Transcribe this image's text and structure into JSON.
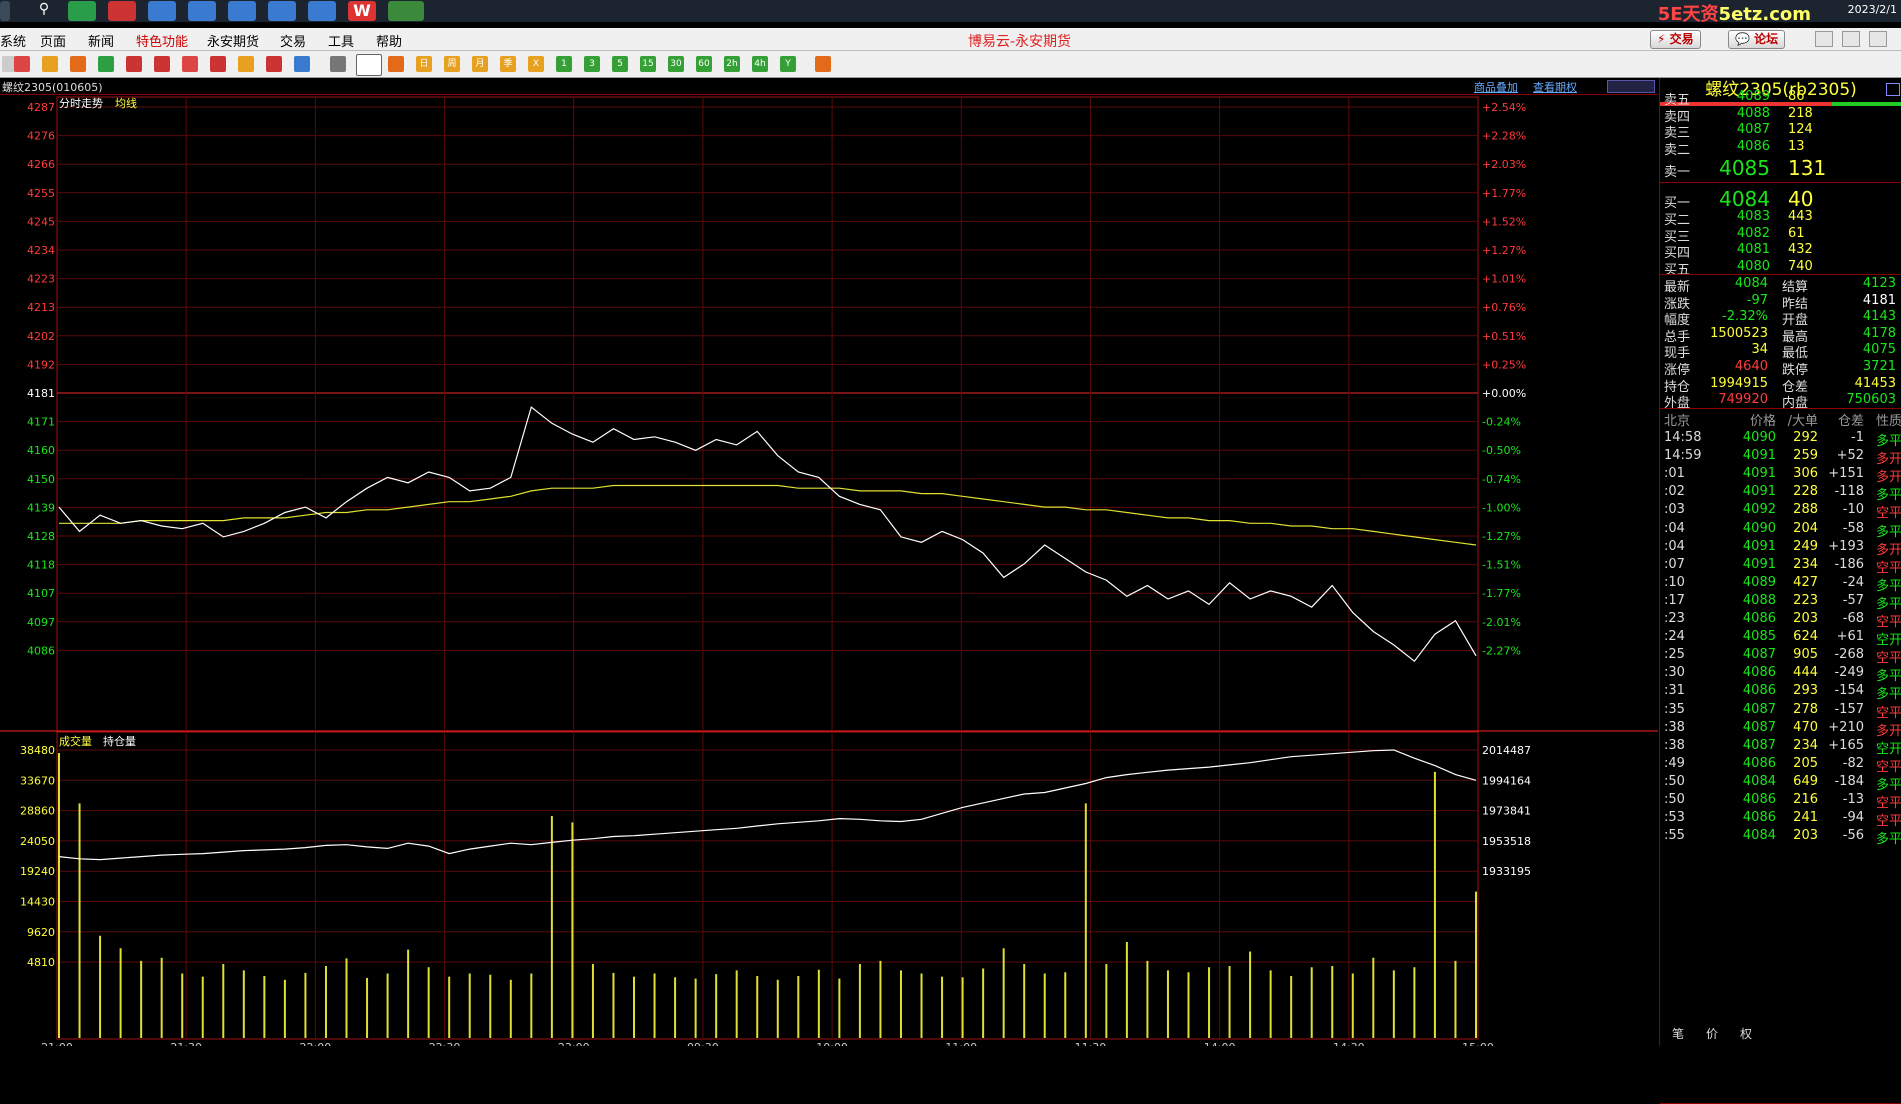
{
  "taskbar": {
    "watermark_a": "5E天资",
    "watermark_b": "5etz.com",
    "date": "2023/2/1"
  },
  "menubar": {
    "items": [
      "系统",
      "页面",
      "新闻",
      "特色功能",
      "永安期货",
      "交易",
      "工具",
      "帮助"
    ],
    "title": "博易云-永安期货",
    "trade_button": "交易",
    "forum_button": "论坛"
  },
  "toolbar": {
    "period_buttons": [
      "日",
      "周",
      "月",
      "季",
      "X",
      "1",
      "3",
      "5",
      "15",
      "30",
      "60",
      "2h",
      "4h",
      "Y"
    ]
  },
  "chart": {
    "header": "螺纹2305(010605)",
    "link_overlay": "商品叠加",
    "link_options": "查看期权",
    "price_legend_a": "分时走势",
    "price_legend_b": "均线",
    "vol_legend_a": "成交量",
    "vol_legend_b": "持仓量"
  },
  "chart_data": {
    "type": "line",
    "price_ticks": [
      4287,
      4276,
      4266,
      4255,
      4245,
      4234,
      4223,
      4213,
      4202,
      4192,
      4181,
      4171,
      4160,
      4150,
      4139,
      4128,
      4118,
      4107,
      4097,
      4086
    ],
    "pct_ticks": [
      "+2.54%",
      "+2.28%",
      "+2.03%",
      "+1.77%",
      "+1.52%",
      "+1.27%",
      "+1.01%",
      "+0.76%",
      "+0.51%",
      "+0.25%",
      "+0.00%",
      "-0.24%",
      "-0.50%",
      "-0.74%",
      "-1.00%",
      "-1.27%",
      "-1.51%",
      "-1.77%",
      "-2.01%",
      "-2.27%"
    ],
    "volume_ticks": [
      38480,
      33670,
      28860,
      24050,
      19240,
      14430,
      9620,
      4810
    ],
    "oi_ticks": [
      2014487,
      1994164,
      1973841,
      1953518,
      1933195
    ],
    "time_ticks": [
      "21:00",
      "21:30",
      "22:00",
      "22:30",
      "23:00",
      "09:30",
      "10:00",
      "11:00",
      "11:30",
      "14:00",
      "14:30",
      "15:00"
    ],
    "prev_settle": 4181,
    "price_series": [
      4139,
      4130,
      4136,
      4133,
      4134,
      4132,
      4131,
      4133,
      4128,
      4130,
      4133,
      4137,
      4139,
      4135,
      4141,
      4146,
      4150,
      4148,
      4152,
      4150,
      4145,
      4146,
      4150,
      4176,
      4170,
      4166,
      4163,
      4168,
      4164,
      4165,
      4163,
      4160,
      4164,
      4162,
      4167,
      4158,
      4152,
      4150,
      4143,
      4140,
      4138,
      4128,
      4126,
      4130,
      4127,
      4122,
      4113,
      4118,
      4125,
      4120,
      4115,
      4112,
      4106,
      4110,
      4105,
      4108,
      4103,
      4111,
      4105,
      4108,
      4106,
      4102,
      4110,
      4100,
      4093,
      4088,
      4082,
      4092,
      4097,
      4084
    ],
    "avg_series": [
      4133,
      4133,
      4133,
      4133,
      4134,
      4134,
      4134,
      4134,
      4134,
      4135,
      4135,
      4135,
      4136,
      4137,
      4137,
      4138,
      4138,
      4139,
      4140,
      4141,
      4141,
      4142,
      4143,
      4145,
      4146,
      4146,
      4146,
      4147,
      4147,
      4147,
      4147,
      4147,
      4147,
      4147,
      4147,
      4147,
      4146,
      4146,
      4146,
      4145,
      4145,
      4145,
      4144,
      4144,
      4143,
      4142,
      4141,
      4140,
      4139,
      4139,
      4138,
      4138,
      4137,
      4136,
      4135,
      4135,
      4134,
      4134,
      4133,
      4133,
      4132,
      4132,
      4131,
      4131,
      4130,
      4129,
      4128,
      4127,
      4126,
      4125
    ],
    "oi_series": [
      1943000,
      1941500,
      1941000,
      1942000,
      1943000,
      1944000,
      1944500,
      1945000,
      1946000,
      1947000,
      1947500,
      1948000,
      1949000,
      1950500,
      1951000,
      1949500,
      1948500,
      1952000,
      1950000,
      1945000,
      1948000,
      1950000,
      1952000,
      1951000,
      1952500,
      1954000,
      1955000,
      1956500,
      1957000,
      1958000,
      1959000,
      1960000,
      1961000,
      1962000,
      1963500,
      1965000,
      1966000,
      1967000,
      1968500,
      1968000,
      1967000,
      1966500,
      1968000,
      1972000,
      1976000,
      1979000,
      1982000,
      1985000,
      1986000,
      1989000,
      1992000,
      1996000,
      1998000,
      1999500,
      2001000,
      2002000,
      2003000,
      2004500,
      2006000,
      2008000,
      2010000,
      2011000,
      2012000,
      2013000,
      2014000,
      2014487,
      2009000,
      2004000,
      1998000,
      1994164
    ],
    "volume_bars": [
      38000,
      30000,
      9000,
      7000,
      5000,
      5500,
      3000,
      2500,
      4500,
      3500,
      2600,
      2000,
      3100,
      4200,
      5400,
      2300,
      3000,
      6800,
      4000,
      2500,
      3000,
      2800,
      2000,
      3000,
      28000,
      27000,
      4500,
      3100,
      2500,
      3000,
      2400,
      2200,
      2900,
      3500,
      2600,
      2000,
      2600,
      3600,
      2200,
      4500,
      5000,
      3500,
      3000,
      2500,
      2400,
      3800,
      7000,
      4500,
      3000,
      3200,
      30000,
      4500,
      8000,
      5000,
      3500,
      3200,
      4000,
      4200,
      6500,
      3500,
      2600,
      4000,
      4200,
      3000,
      5500,
      3500,
      4000,
      35000,
      5000,
      16000
    ]
  },
  "panel": {
    "title": "螺纹2305(rb2305)",
    "asks": [
      {
        "label": "卖五",
        "price": "4089",
        "vol": "86"
      },
      {
        "label": "卖四",
        "price": "4088",
        "vol": "218"
      },
      {
        "label": "卖三",
        "price": "4087",
        "vol": "124"
      },
      {
        "label": "卖二",
        "price": "4086",
        "vol": "13"
      },
      {
        "label": "卖一",
        "price": "4085",
        "vol": "131"
      }
    ],
    "bids": [
      {
        "label": "买一",
        "price": "4084",
        "vol": "40"
      },
      {
        "label": "买二",
        "price": "4083",
        "vol": "443"
      },
      {
        "label": "买三",
        "price": "4082",
        "vol": "61"
      },
      {
        "label": "买四",
        "price": "4081",
        "vol": "432"
      },
      {
        "label": "买五",
        "price": "4080",
        "vol": "740"
      }
    ],
    "quote": [
      {
        "l1": "最新",
        "v1": "4084",
        "c1": "grn",
        "l2": "结算",
        "v2": "4123",
        "c2": "grn"
      },
      {
        "l1": "涨跌",
        "v1": "-97",
        "c1": "grn",
        "l2": "昨结",
        "v2": "4181",
        "c2": "wht"
      },
      {
        "l1": "幅度",
        "v1": "-2.32%",
        "c1": "grn",
        "l2": "开盘",
        "v2": "4143",
        "c2": "grn"
      },
      {
        "l1": "总手",
        "v1": "1500523",
        "c1": "yel",
        "l2": "最高",
        "v2": "4178",
        "c2": "grn"
      },
      {
        "l1": "现手",
        "v1": "34",
        "c1": "yel",
        "l2": "最低",
        "v2": "4075",
        "c2": "grn"
      },
      {
        "l1": "涨停",
        "v1": "4640",
        "c1": "red",
        "l2": "跌停",
        "v2": "3721",
        "c2": "grn"
      },
      {
        "l1": "持仓",
        "v1": "1994915",
        "c1": "yel",
        "l2": "仓差",
        "v2": "41453",
        "c2": "yel"
      },
      {
        "l1": "外盘",
        "v1": "749920",
        "c1": "red",
        "l2": "内盘",
        "v2": "750603",
        "c2": "grn"
      }
    ],
    "ticks_header": {
      "time": "北京",
      "price": "价格",
      "vol": "/大单",
      "oi": "仓差",
      "nature": "性质"
    },
    "ticks": [
      {
        "t": "14:58",
        "p": "4090",
        "pc": "grn",
        "v": "292",
        "d": "-1",
        "k": "多平",
        "kc": "grn"
      },
      {
        "t": "14:59",
        "p": "4091",
        "pc": "grn",
        "v": "259",
        "d": "+52",
        "k": "多开",
        "kc": "red"
      },
      {
        "t": ":01",
        "p": "4091",
        "pc": "grn",
        "v": "306",
        "d": "+151",
        "k": "多开",
        "kc": "red"
      },
      {
        "t": ":02",
        "p": "4091",
        "pc": "grn",
        "v": "228",
        "d": "-118",
        "k": "多平",
        "kc": "grn"
      },
      {
        "t": ":03",
        "p": "4092",
        "pc": "grn",
        "v": "288",
        "d": "-10",
        "k": "空平",
        "kc": "red"
      },
      {
        "t": ":04",
        "p": "4090",
        "pc": "grn",
        "v": "204",
        "d": "-58",
        "k": "多平",
        "kc": "grn"
      },
      {
        "t": ":04",
        "p": "4091",
        "pc": "grn",
        "v": "249",
        "d": "+193",
        "k": "多开",
        "kc": "red"
      },
      {
        "t": ":07",
        "p": "4091",
        "pc": "grn",
        "v": "234",
        "d": "-186",
        "k": "空平",
        "kc": "red"
      },
      {
        "t": ":10",
        "p": "4089",
        "pc": "grn",
        "v": "427",
        "d": "-24",
        "k": "多平",
        "kc": "grn"
      },
      {
        "t": ":17",
        "p": "4088",
        "pc": "grn",
        "v": "223",
        "d": "-57",
        "k": "多平",
        "kc": "grn"
      },
      {
        "t": ":23",
        "p": "4086",
        "pc": "grn",
        "v": "203",
        "d": "-68",
        "k": "空平",
        "kc": "red"
      },
      {
        "t": ":24",
        "p": "4085",
        "pc": "grn",
        "v": "624",
        "d": "+61",
        "k": "空开",
        "kc": "grn"
      },
      {
        "t": ":25",
        "p": "4087",
        "pc": "grn",
        "v": "905",
        "d": "-268",
        "k": "空平",
        "kc": "red"
      },
      {
        "t": ":30",
        "p": "4086",
        "pc": "grn",
        "v": "444",
        "d": "-249",
        "k": "多平",
        "kc": "grn"
      },
      {
        "t": ":31",
        "p": "4086",
        "pc": "grn",
        "v": "293",
        "d": "-154",
        "k": "多平",
        "kc": "grn"
      },
      {
        "t": ":35",
        "p": "4087",
        "pc": "grn",
        "v": "278",
        "d": "-157",
        "k": "空平",
        "kc": "red"
      },
      {
        "t": ":38",
        "p": "4087",
        "pc": "grn",
        "v": "470",
        "d": "+210",
        "k": "多开",
        "kc": "red"
      },
      {
        "t": ":38",
        "p": "4087",
        "pc": "grn",
        "v": "234",
        "d": "+165",
        "k": "空开",
        "kc": "grn"
      },
      {
        "t": ":49",
        "p": "4086",
        "pc": "grn",
        "v": "205",
        "d": "-82",
        "k": "空平",
        "kc": "red"
      },
      {
        "t": ":50",
        "p": "4084",
        "pc": "grn",
        "v": "649",
        "d": "-184",
        "k": "多平",
        "kc": "grn"
      },
      {
        "t": ":50",
        "p": "4086",
        "pc": "grn",
        "v": "216",
        "d": "-13",
        "k": "空平",
        "kc": "red"
      },
      {
        "t": ":53",
        "p": "4086",
        "pc": "grn",
        "v": "241",
        "d": "-94",
        "k": "空平",
        "kc": "red"
      },
      {
        "t": ":55",
        "p": "4084",
        "pc": "grn",
        "v": "203",
        "d": "-56",
        "k": "多平",
        "kc": "grn"
      }
    ],
    "tabs": [
      "笔",
      "价",
      "权"
    ]
  }
}
